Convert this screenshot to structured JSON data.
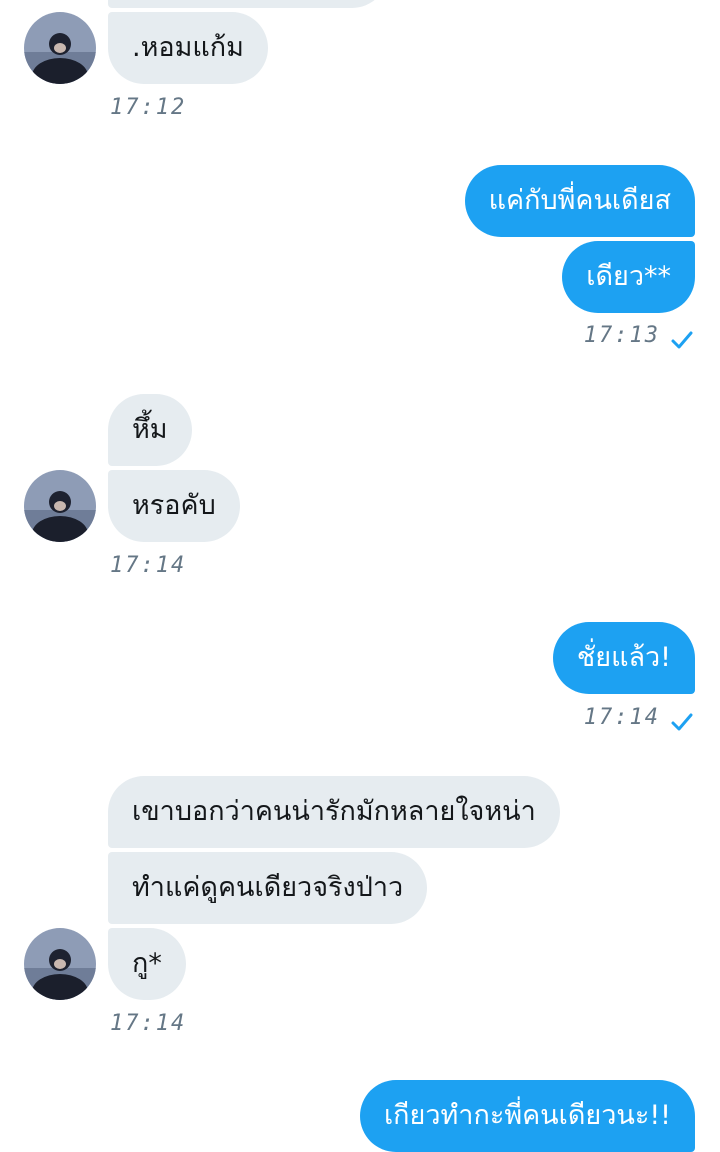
{
  "colors": {
    "incoming_bubble": "#e6ecf0",
    "outgoing_bubble": "#1da1f2",
    "timestamp": "#657786",
    "read_check": "#1da1f2"
  },
  "messages": [
    {
      "id": "m1",
      "direction": "incoming",
      "text": ".หอมแก้ม"
    },
    {
      "id": "t1",
      "type": "timestamp",
      "text": "17:12"
    },
    {
      "id": "m2",
      "direction": "outgoing",
      "text": "แค่กับพี่คนเดียส"
    },
    {
      "id": "m3",
      "direction": "outgoing",
      "text": "เดียว**"
    },
    {
      "id": "t2",
      "type": "timestamp",
      "text": "17:13",
      "read_icon": "check-icon"
    },
    {
      "id": "m4",
      "direction": "incoming",
      "text": "หึ้ม"
    },
    {
      "id": "m5",
      "direction": "incoming",
      "text": "หรอคับ"
    },
    {
      "id": "t3",
      "type": "timestamp",
      "text": "17:14"
    },
    {
      "id": "m6",
      "direction": "outgoing",
      "text": "ชั่ยแล้ว!"
    },
    {
      "id": "t4",
      "type": "timestamp",
      "text": "17:14",
      "read_icon": "check-icon"
    },
    {
      "id": "m7",
      "direction": "incoming",
      "text": "เขาบอกว่าคนน่ารักมักหลายใจหน่า"
    },
    {
      "id": "m8",
      "direction": "incoming",
      "text": "ทำแค่ดูคนเดียวจริงป่าว"
    },
    {
      "id": "m9",
      "direction": "incoming",
      "text": "กู*"
    },
    {
      "id": "t5",
      "type": "timestamp",
      "text": "17:14"
    },
    {
      "id": "m10",
      "direction": "outgoing",
      "text": "เกียวทำกะพี่คนเดียวนะ!!"
    }
  ],
  "avatar_icon": "contact-avatar"
}
